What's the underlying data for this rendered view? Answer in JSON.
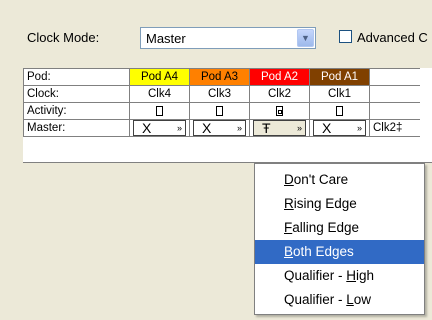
{
  "clock_mode": {
    "label": "Clock Mode:",
    "value": "Master",
    "advanced_label": "Advanced C"
  },
  "grid": {
    "row_labels": [
      "Pod:",
      "Clock:",
      "Activity:",
      "Master:"
    ],
    "pods": [
      {
        "name": "Pod A4",
        "color": "#ffff00",
        "clock": "Clk4",
        "master_symbol": "X"
      },
      {
        "name": "Pod A3",
        "color": "#ff8000",
        "clock": "Clk3",
        "master_symbol": "X"
      },
      {
        "name": "Pod A2",
        "color": "#ff0000",
        "clock": "Clk2",
        "master_symbol": "Ŧ"
      },
      {
        "name": "Pod A1",
        "color": "#804000",
        "clock": "Clk1",
        "master_symbol": "X"
      }
    ],
    "extra_master": "Clk2‡"
  },
  "menu": {
    "items": [
      {
        "pre": "",
        "accel": "D",
        "post": "on't Care"
      },
      {
        "pre": "",
        "accel": "R",
        "post": "ising Edge"
      },
      {
        "pre": "",
        "accel": "F",
        "post": "alling Edge"
      },
      {
        "pre": "",
        "accel": "B",
        "post": "oth Edges"
      },
      {
        "pre": "Qualifier - ",
        "accel": "H",
        "post": "igh"
      },
      {
        "pre": "Qualifier - ",
        "accel": "L",
        "post": "ow"
      }
    ],
    "selected_index": 3
  }
}
